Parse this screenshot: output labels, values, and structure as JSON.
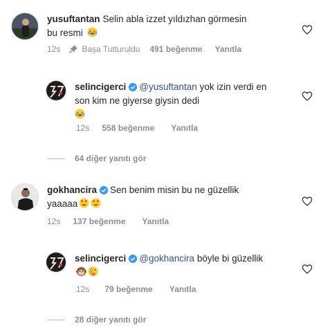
{
  "comments": [
    {
      "username": "yusuftantan",
      "text": "Selin abla izzet yıldızhan görmesin bu resmi",
      "emoji": "laughing-tears",
      "time": "12s",
      "pinned": "Başa Tutturuldu",
      "likes": "491 beğenme",
      "reply": "Yanıtla"
    },
    {
      "username": "selincigerci",
      "mention": "@yusuftantan",
      "text": "yok izin verdi en son kim ne giyerse giysin dedi",
      "emoji": "laughing-tears",
      "time": "12s",
      "likes": "558 beğenme",
      "reply": "Yanıtla"
    },
    {
      "username": "gokhancira",
      "text": "Sen benim misin bu ne güzellik yaaaaa",
      "emoji": "heart-eyes",
      "time": "12s",
      "likes": "137 beğenme",
      "reply": "Yanıtla"
    },
    {
      "username": "selincigerci",
      "mention": "@gokhancira",
      "text": "böyle bi güzellik",
      "emoji": "monkey, zany-face",
      "time": "12s",
      "likes": "79 beğenme",
      "reply": "Yanıtla"
    }
  ],
  "view_replies": [
    "64 diğer yanıtı gör",
    "28 diğer yanıtı gör"
  ],
  "colors": {
    "verified": "#3897f0",
    "meta": "#8e8e8e",
    "mention": "#3d4f7c"
  }
}
